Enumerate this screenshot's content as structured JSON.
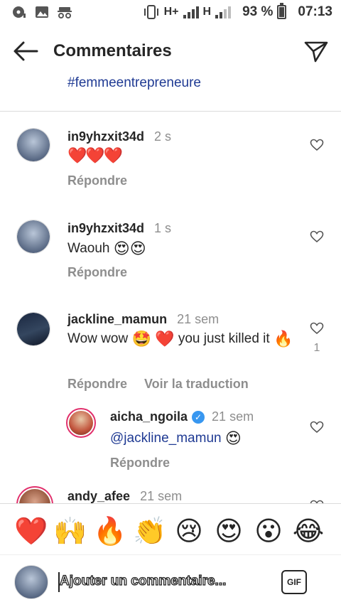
{
  "status_bar": {
    "network_a": "H+",
    "network_b": "H",
    "battery": "93 %",
    "time": "07:13"
  },
  "header": {
    "title": "Commentaires"
  },
  "caption": {
    "hashtag": "#femmeentrepreneure"
  },
  "comments": [
    {
      "username": "in9yhzxit34d",
      "time": "2 s",
      "text": "❤️❤️❤️",
      "reply_label": "Répondre"
    },
    {
      "username": "in9yhzxit34d",
      "time": "1 s",
      "text": "Waouh",
      "emoji": "😍😍",
      "reply_label": "Répondre"
    },
    {
      "username": "jackline_mamun",
      "time": "21 sem",
      "text_a": "Wow wow",
      "emoji_a": "🤩",
      "emoji_b": "❤️",
      "text_b": "you just killed it",
      "emoji_c": "🔥",
      "likes": "1",
      "reply_label": "Répondre",
      "translate_label": "Voir la traduction"
    },
    {
      "username": "aicha_ngoila",
      "time": "21 sem",
      "mention": "@jackline_mamun",
      "emoji": "😍",
      "reply_label": "Répondre",
      "verified": true
    },
    {
      "username": "andy_afee",
      "time": "21 sem"
    }
  ],
  "emoji_bar": [
    "❤️",
    "🙌",
    "🔥",
    "👏",
    "😢",
    "😍",
    "😮",
    "😂"
  ],
  "composer": {
    "placeholder": "Ajouter un commentaire...",
    "gif_label": "GIF"
  },
  "colors": {
    "link_blue": "#1f3a93",
    "muted_grey": "#8e8e8e",
    "verified_blue": "#3897f0"
  }
}
